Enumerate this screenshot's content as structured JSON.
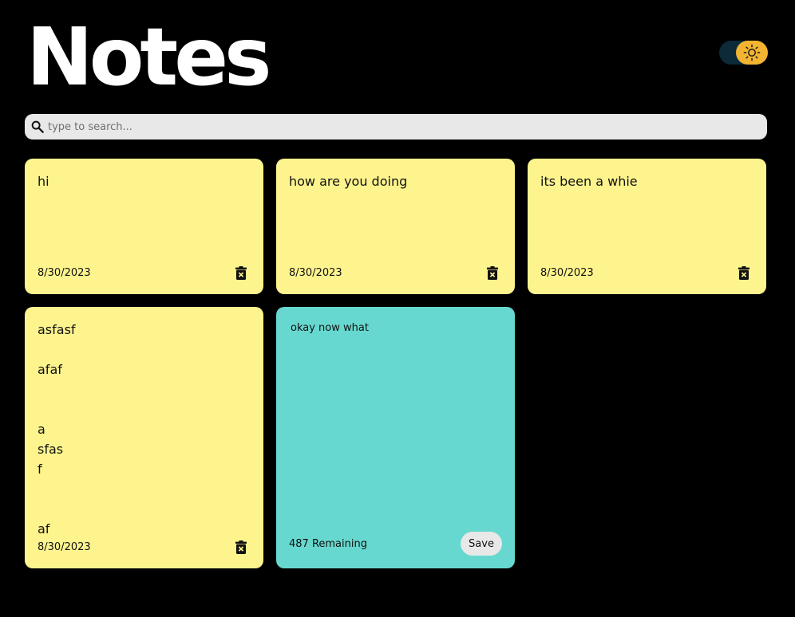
{
  "app": {
    "title": "Notes"
  },
  "theme_toggle": {
    "mode": "light",
    "icon": "sun-icon",
    "track_color": "#0c2a38",
    "knob_color": "#f3b431"
  },
  "search": {
    "placeholder": "type to search...",
    "value": ""
  },
  "colors": {
    "background": "#000000",
    "note": "#fef48e",
    "new_note": "#67d8cf",
    "search_bg": "#e8e8e8",
    "save_bg": "#e8e8e8"
  },
  "notes": [
    {
      "text": "hi",
      "date": "8/30/2023"
    },
    {
      "text": "how are you doing",
      "date": "8/30/2023"
    },
    {
      "text": "its been a whie",
      "date": "8/30/2023"
    },
    {
      "text": "asfasf\n\nafaf\n\n\na\nsfas\nf\n\n\naf",
      "date": "8/30/2023"
    }
  ],
  "new_note": {
    "text": "okay now what",
    "remaining_label": "487 Remaining",
    "save_label": "Save"
  }
}
